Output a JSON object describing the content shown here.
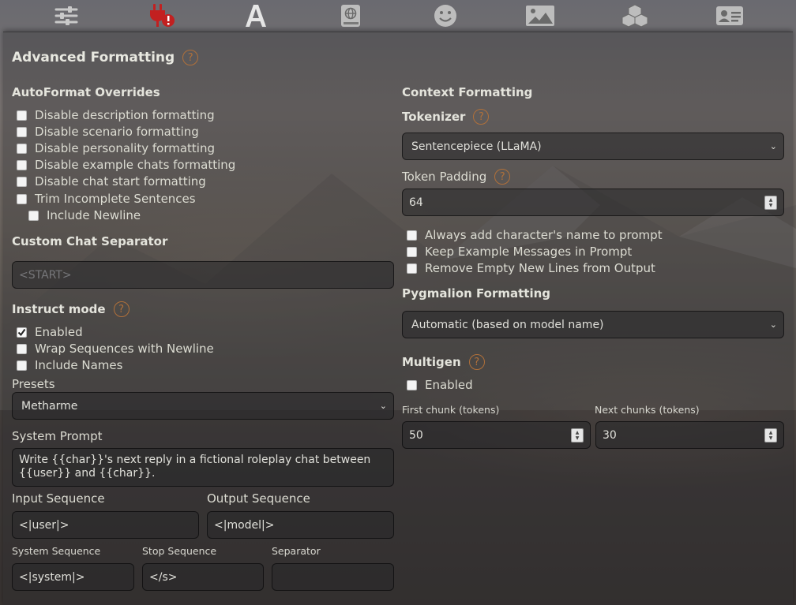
{
  "nav": {
    "icons": [
      "sliders-icon",
      "plug-warning-icon",
      "font-a-icon",
      "book-globe-icon",
      "smiley-icon",
      "image-icon",
      "cubes-icon",
      "id-card-icon"
    ]
  },
  "title": "Advanced Formatting",
  "left": {
    "autoformat": {
      "heading": "AutoFormat Overrides",
      "items": [
        {
          "label": "Disable description formatting",
          "checked": false
        },
        {
          "label": "Disable scenario formatting",
          "checked": false
        },
        {
          "label": "Disable personality formatting",
          "checked": false
        },
        {
          "label": "Disable example chats formatting",
          "checked": false
        },
        {
          "label": "Disable chat start formatting",
          "checked": false
        },
        {
          "label": "Trim Incomplete Sentences",
          "checked": false
        },
        {
          "label": "Include Newline",
          "checked": false
        }
      ]
    },
    "separator": {
      "heading": "Custom Chat Separator",
      "placeholder": "<START>"
    },
    "instruct": {
      "heading": "Instruct mode",
      "items": [
        {
          "label": "Enabled",
          "checked": true
        },
        {
          "label": "Wrap Sequences with Newline",
          "checked": false
        },
        {
          "label": "Include Names",
          "checked": false
        }
      ],
      "presets_label": "Presets",
      "preset_value": "Metharme",
      "system_prompt_label": "System Prompt",
      "system_prompt_value": "Write {{char}}'s next reply in a fictional roleplay chat between {{user}} and {{char}}.",
      "input_seq_label": "Input Sequence",
      "input_seq_value": "<|user|>",
      "output_seq_label": "Output Sequence",
      "output_seq_value": "<|model|>",
      "system_seq_label": "System Sequence",
      "system_seq_value": "<|system|>",
      "stop_seq_label": "Stop Sequence",
      "stop_seq_value": "</s>",
      "separator_label": "Separator",
      "separator_value": ""
    }
  },
  "right": {
    "context": {
      "heading": "Context Formatting",
      "tokenizer_label": "Tokenizer",
      "tokenizer_value": "Sentencepiece (LLaMA)",
      "padding_label": "Token Padding",
      "padding_value": "64",
      "items": [
        {
          "label": "Always add character's name to prompt",
          "checked": false
        },
        {
          "label": "Keep Example Messages in Prompt",
          "checked": false
        },
        {
          "label": "Remove Empty New Lines from Output",
          "checked": false
        }
      ]
    },
    "pygmalion": {
      "heading": "Pygmalion Formatting",
      "value": "Automatic (based on model name)"
    },
    "multigen": {
      "heading": "Multigen",
      "enabled_label": "Enabled",
      "enabled": false,
      "first_label": "First chunk (tokens)",
      "first_value": "50",
      "next_label": "Next chunks (tokens)",
      "next_value": "30"
    }
  },
  "colors": {
    "help_icon": "#b0703a",
    "active_warning_icon": "#c22020"
  }
}
